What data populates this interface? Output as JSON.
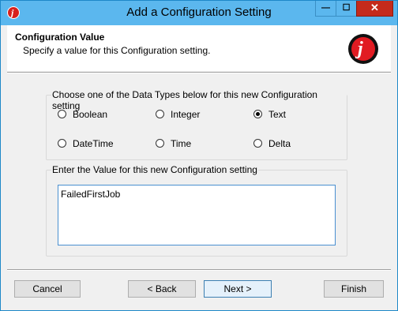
{
  "window": {
    "title": "Add a Configuration Setting",
    "buttons": {
      "minimize": "—",
      "maximize": "☐",
      "close": "✕"
    },
    "icon": "app-logo-icon"
  },
  "header": {
    "title": "Configuration Value",
    "subtitle": "Specify a value for this Configuration setting.",
    "logo_letter": "j"
  },
  "data_types": {
    "label": "Choose one of the Data Types below for this new Configuration setting",
    "options": [
      {
        "label": "Boolean",
        "selected": false
      },
      {
        "label": "Integer",
        "selected": false
      },
      {
        "label": "Text",
        "selected": true
      },
      {
        "label": "DateTime",
        "selected": false
      },
      {
        "label": "Time",
        "selected": false
      },
      {
        "label": "Delta",
        "selected": false
      }
    ]
  },
  "value_group": {
    "label": "Enter the Value for this new Configuration setting",
    "value": "FailedFirstJob"
  },
  "footer": {
    "cancel": "Cancel",
    "back": "< Back",
    "next": "Next >",
    "finish": "Finish"
  },
  "colors": {
    "titlebar": "#5bb7ee",
    "close_button": "#c42b1c",
    "logo_red": "#e11b22"
  }
}
